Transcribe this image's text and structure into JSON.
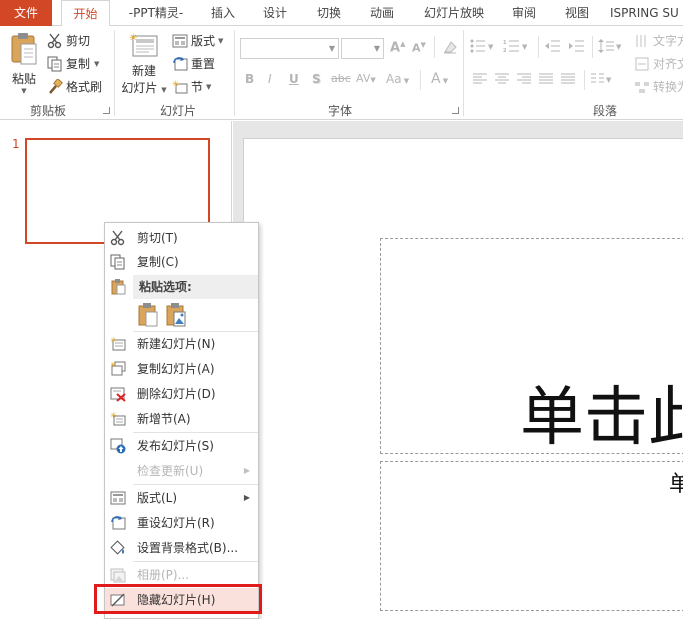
{
  "tabs": [
    "文件",
    "开始",
    "-PPT精灵-",
    "插入",
    "设计",
    "切换",
    "动画",
    "幻灯片放映",
    "审阅",
    "视图",
    "ISPRING SU"
  ],
  "ribbon": {
    "clipboard": {
      "paste": "粘贴",
      "cut": "剪切",
      "copy": "复制",
      "format_painter": "格式刷",
      "label": "剪贴板"
    },
    "slides": {
      "new_slide_line1": "新建",
      "new_slide_line2": "幻灯片",
      "layout": "版式",
      "reset": "重置",
      "section": "节",
      "label": "幻灯片"
    },
    "font": {
      "label": "字体",
      "bold": "B",
      "italic": "I",
      "underline": "U",
      "shadow": "S",
      "strike": "abc",
      "spacing": "AV",
      "case": "Aa",
      "color": "A",
      "grow": "A",
      "shrink": "A"
    },
    "paragraph": {
      "text_direction": "文字方",
      "align_text": "对齐文",
      "convert": "转换为",
      "label": "段落"
    }
  },
  "slides_pane": {
    "slide_number": "1"
  },
  "slide": {
    "title_text": "单击此",
    "subtitle_text": "单"
  },
  "context_menu": {
    "cut": "剪切(T)",
    "copy": "复制(C)",
    "paste_options": "粘贴选项:",
    "new_slide": "新建幻灯片(N)",
    "duplicate_slide": "复制幻灯片(A)",
    "delete_slide": "删除幻灯片(D)",
    "add_section": "新增节(A)",
    "publish_slides": "发布幻灯片(S)",
    "check_updates": "检查更新(U)",
    "layout": "版式(L)",
    "reset_slide": "重设幻灯片(R)",
    "format_background": "设置背景格式(B)...",
    "photo_album": "相册(P)...",
    "hide_slide": "隐藏幻灯片(H)"
  },
  "colors": {
    "accent": "#d24726",
    "highlight_border": "#e01b1b"
  }
}
